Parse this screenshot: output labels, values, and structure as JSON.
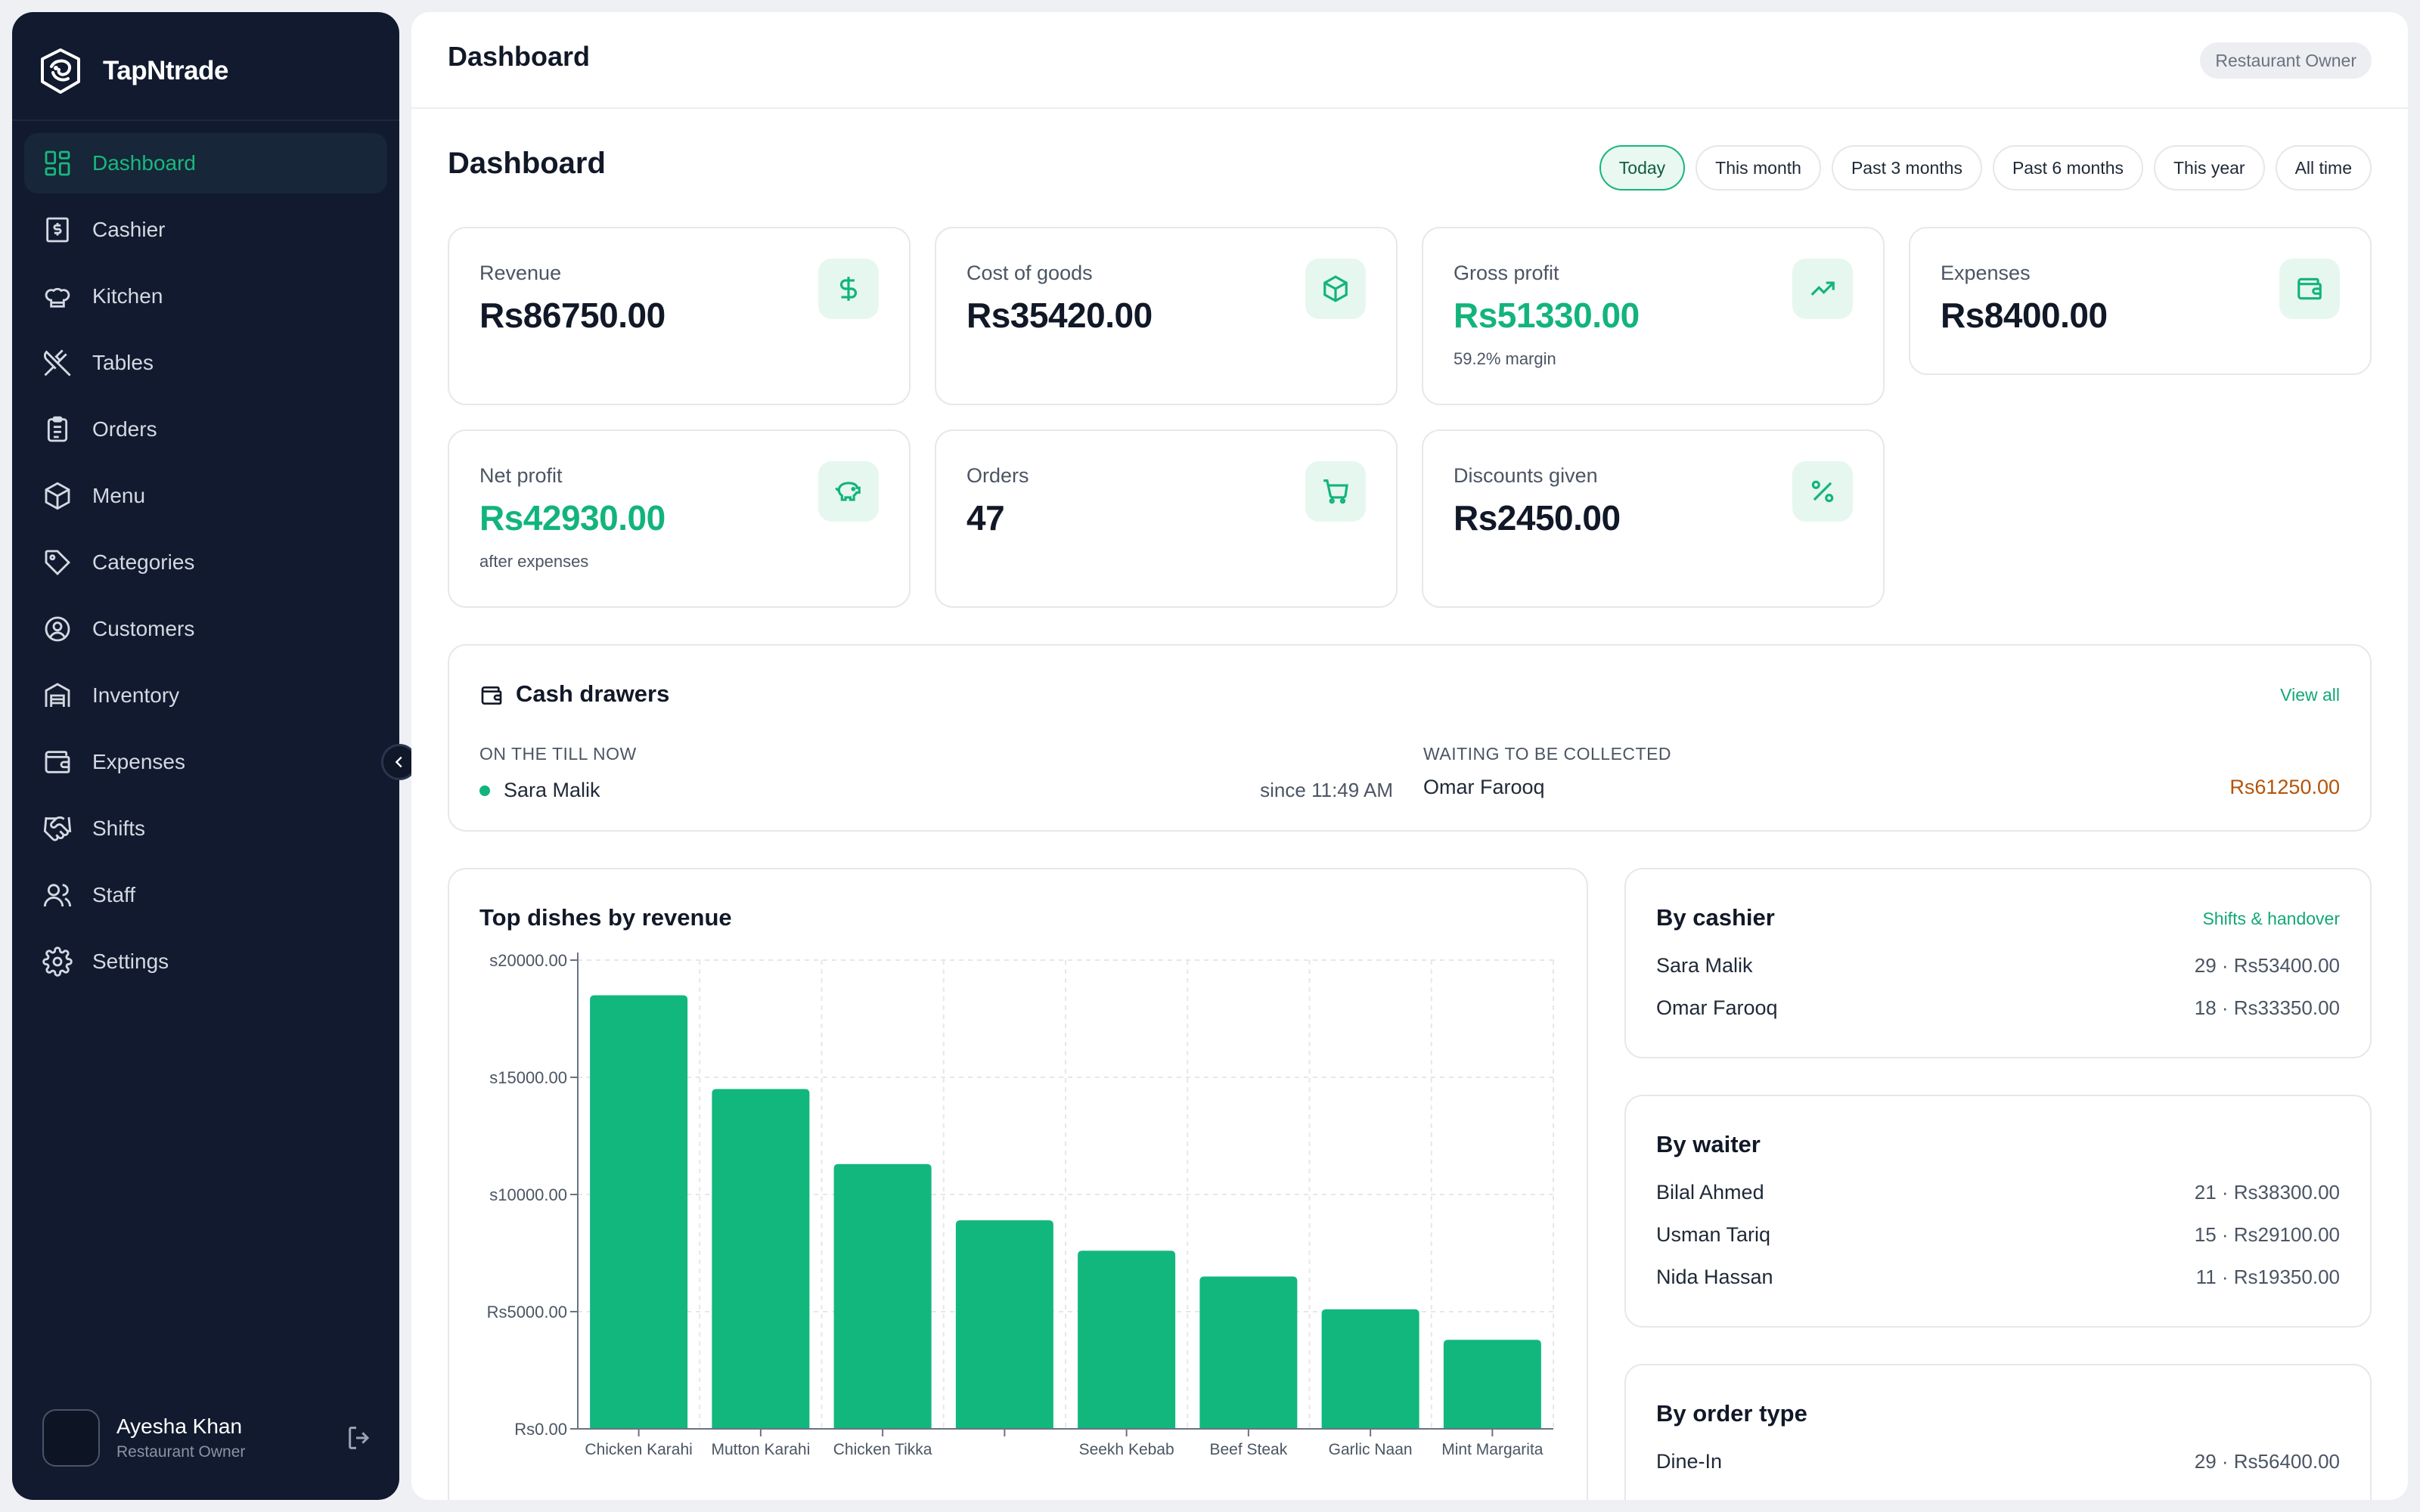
{
  "brand": {
    "name": "TapNtrade"
  },
  "sidebar": {
    "items": [
      {
        "label": "Dashboard",
        "icon": "dashboard-grid-icon",
        "active": true
      },
      {
        "label": "Cashier",
        "icon": "receipt-dollar-icon"
      },
      {
        "label": "Kitchen",
        "icon": "chef-hat-icon"
      },
      {
        "label": "Tables",
        "icon": "utensils-crossed-icon"
      },
      {
        "label": "Orders",
        "icon": "clipboard-list-icon"
      },
      {
        "label": "Menu",
        "icon": "box-icon"
      },
      {
        "label": "Categories",
        "icon": "tag-icon"
      },
      {
        "label": "Customers",
        "icon": "user-circle-icon"
      },
      {
        "label": "Inventory",
        "icon": "warehouse-icon"
      },
      {
        "label": "Expenses",
        "icon": "wallet-icon"
      },
      {
        "label": "Shifts",
        "icon": "handshake-icon"
      },
      {
        "label": "Staff",
        "icon": "users-icon"
      },
      {
        "label": "Settings",
        "icon": "gear-icon"
      }
    ],
    "user": {
      "name": "Ayesha Khan",
      "role": "Restaurant Owner"
    }
  },
  "topbar": {
    "title": "Dashboard",
    "role_badge": "Restaurant Owner"
  },
  "page": {
    "title": "Dashboard",
    "filters": [
      {
        "label": "Today",
        "active": true
      },
      {
        "label": "This month"
      },
      {
        "label": "Past 3 months"
      },
      {
        "label": "Past 6 months"
      },
      {
        "label": "This year"
      },
      {
        "label": "All time"
      }
    ]
  },
  "stats": {
    "revenue": {
      "label": "Revenue",
      "value": "Rs86750.00",
      "icon": "dollar-icon"
    },
    "cogs": {
      "label": "Cost of goods",
      "value": "Rs35420.00",
      "icon": "box-icon"
    },
    "gross": {
      "label": "Gross profit",
      "value": "Rs51330.00",
      "sub": "59.2% margin",
      "icon": "trending-up-icon"
    },
    "expenses": {
      "label": "Expenses",
      "value": "Rs8400.00",
      "icon": "wallet-icon"
    },
    "net": {
      "label": "Net profit",
      "value": "Rs42930.00",
      "sub": "after expenses",
      "icon": "piggy-bank-icon"
    },
    "orders": {
      "label": "Orders",
      "value": "47",
      "icon": "cart-icon"
    },
    "discounts": {
      "label": "Discounts given",
      "value": "Rs2450.00",
      "icon": "percent-icon"
    }
  },
  "cash_drawers": {
    "title": "Cash drawers",
    "view_all": "View all",
    "on_till_label": "ON THE TILL NOW",
    "on_till_name": "Sara Malik",
    "on_till_since": "since 11:49 AM",
    "waiting_label": "WAITING TO BE COLLECTED",
    "waiting_name": "Omar Farooq",
    "waiting_amount": "Rs61250.00"
  },
  "chart_data": {
    "type": "bar",
    "title": "Top dishes by revenue",
    "categories": [
      "Chicken Karahi",
      "Mutton Karahi",
      "Chicken Tikka",
      "",
      "Seekh Kebab",
      "Beef Steak",
      "Garlic Naan",
      "Mint Margarita"
    ],
    "values": [
      18500,
      14500,
      11300,
      8900,
      7600,
      6500,
      5100,
      3800
    ],
    "y_ticks": [
      "Rs0.00",
      "Rs5000.00",
      "s10000.00",
      "s15000.00",
      "s20000.00"
    ],
    "ylim": [
      0,
      20000
    ],
    "grid": true,
    "color": "#12b77e"
  },
  "by_cashier": {
    "title": "By cashier",
    "link": "Shifts & handover",
    "rows": [
      {
        "name": "Sara Malik",
        "value": "29 · Rs53400.00"
      },
      {
        "name": "Omar Farooq",
        "value": "18 · Rs33350.00"
      }
    ]
  },
  "by_waiter": {
    "title": "By waiter",
    "rows": [
      {
        "name": "Bilal Ahmed",
        "value": "21 · Rs38300.00"
      },
      {
        "name": "Usman Tariq",
        "value": "15 · Rs29100.00"
      },
      {
        "name": "Nida Hassan",
        "value": "11 · Rs19350.00"
      }
    ]
  },
  "by_order_type": {
    "title": "By order type",
    "rows": [
      {
        "name": "Dine-In",
        "value": "29 · Rs56400.00"
      }
    ]
  },
  "colors": {
    "accent": "#12b47c",
    "sidebar": "#111a2e",
    "amber": "#b45309"
  }
}
